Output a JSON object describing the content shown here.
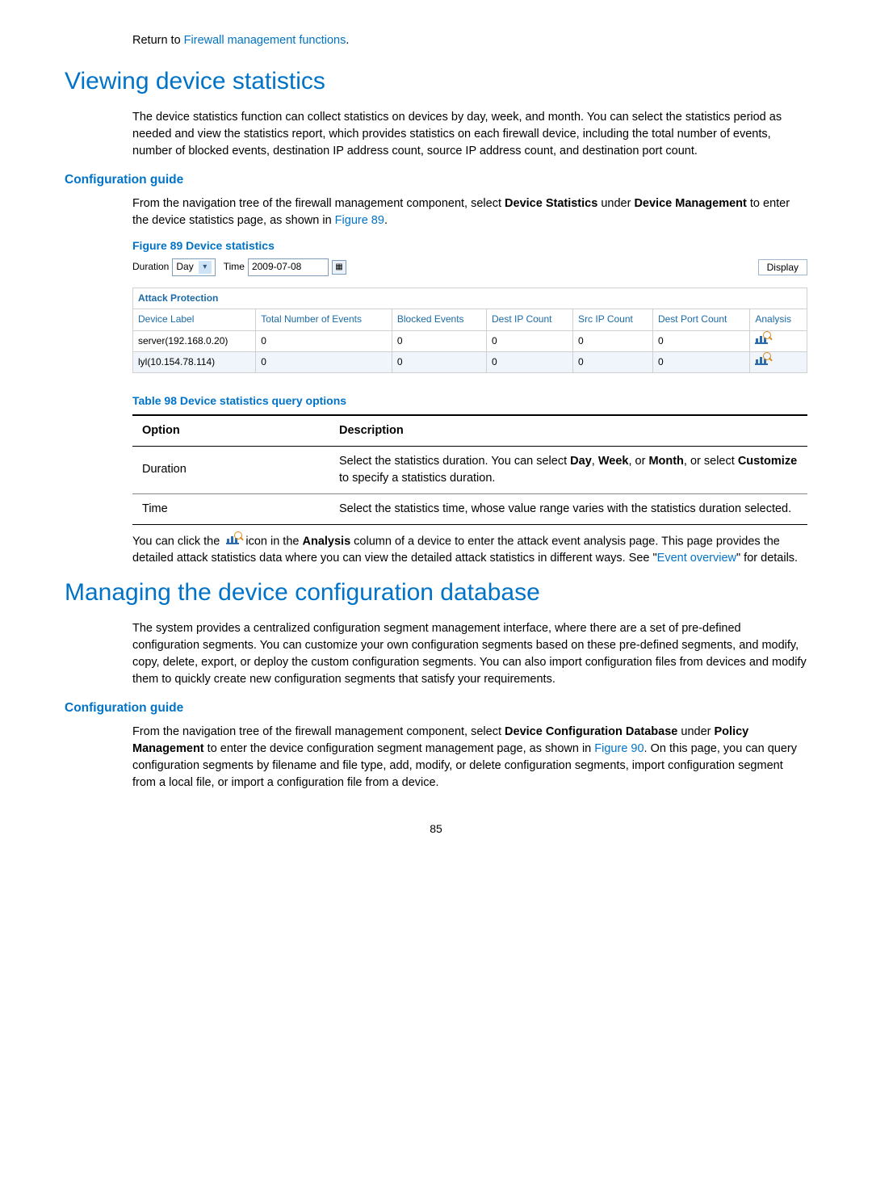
{
  "top": {
    "return_prefix": "Return to ",
    "return_link": "Firewall management functions",
    "return_suffix": "."
  },
  "section1": {
    "heading": "Viewing device statistics",
    "para": "The device statistics function can collect statistics on devices by day, week, and month. You can select the statistics period as needed and view the statistics report, which provides statistics on each firewall device, including the total number of events, number of blocked events, destination IP address count, source IP address count, and destination port count.",
    "config_guide": "Configuration guide",
    "para2_a": "From the navigation tree of the firewall management component, select ",
    "para2_b_bold": "Device Statistics",
    "para2_c": " under ",
    "para2_d_bold": "Device Management",
    "para2_e": " to enter the device statistics page, as shown in ",
    "para2_link": "Figure 89",
    "para2_suffix": "."
  },
  "figure89": {
    "caption": "Figure 89 Device statistics",
    "duration_label": "Duration",
    "duration_value": "Day",
    "time_label": "Time",
    "time_value": "2009-07-08",
    "display_btn": "Display",
    "section_title": "Attack Protection",
    "headers": [
      "Device Label",
      "Total Number of Events",
      "Blocked Events",
      "Dest IP Count",
      "Src IP Count",
      "Dest Port Count",
      "Analysis"
    ],
    "rows": [
      {
        "label": "server(192.168.0.20)",
        "total": "0",
        "blocked": "0",
        "dest": "0",
        "src": "0",
        "port": "0"
      },
      {
        "label": "lyl(10.154.78.114)",
        "total": "0",
        "blocked": "0",
        "dest": "0",
        "src": "0",
        "port": "0"
      }
    ]
  },
  "table98": {
    "caption": "Table 98 Device statistics query options",
    "col_option": "Option",
    "col_desc": "Description",
    "rows": [
      {
        "opt": "Duration",
        "d_a": "Select the statistics duration. You can select ",
        "d_bold1": "Day",
        "d_s1": ", ",
        "d_bold2": "Week",
        "d_s2": ", or ",
        "d_bold3": "Month",
        "d_s3": ", or select ",
        "d_bold4": "Customize",
        "d_end": " to specify a statistics duration."
      },
      {
        "opt": "Time",
        "d_a": "Select the statistics time, whose value range varies with the statistics duration selected.",
        "d_bold1": "",
        "d_s1": "",
        "d_bold2": "",
        "d_s2": "",
        "d_bold3": "",
        "d_s3": "",
        "d_bold4": "",
        "d_end": ""
      }
    ]
  },
  "after_table": {
    "p_a": "You can click the ",
    "p_b": " icon in the ",
    "p_bold": "Analysis",
    "p_c": " column of a device to enter the attack event analysis page. This page provides the detailed attack statistics data where you can view the detailed attack statistics in different ways. See \"",
    "p_link": "Event overview",
    "p_d": "\" for details."
  },
  "section2": {
    "heading": "Managing the device configuration database",
    "para": "The system provides a centralized configuration segment management interface, where there are a set of pre-defined configuration segments. You can customize your own configuration segments based on these pre-defined segments, and modify, copy, delete, export, or deploy the custom configuration segments. You can also import configuration files from devices and modify them to quickly create new configuration segments that satisfy your requirements.",
    "config_guide": "Configuration guide",
    "p2_a": "From the navigation tree of the firewall management component, select ",
    "p2_bold1": "Device Configuration Database",
    "p2_b": " under ",
    "p2_bold2": "Policy Management",
    "p2_c": " to enter the device configuration segment management page, as shown in ",
    "p2_link": "Figure 90",
    "p2_d": ". On this page, you can query configuration segments by filename and file type, add, modify, or delete configuration segments, import configuration segment from a local file, or import a configuration file from a device."
  },
  "page_number": "85"
}
